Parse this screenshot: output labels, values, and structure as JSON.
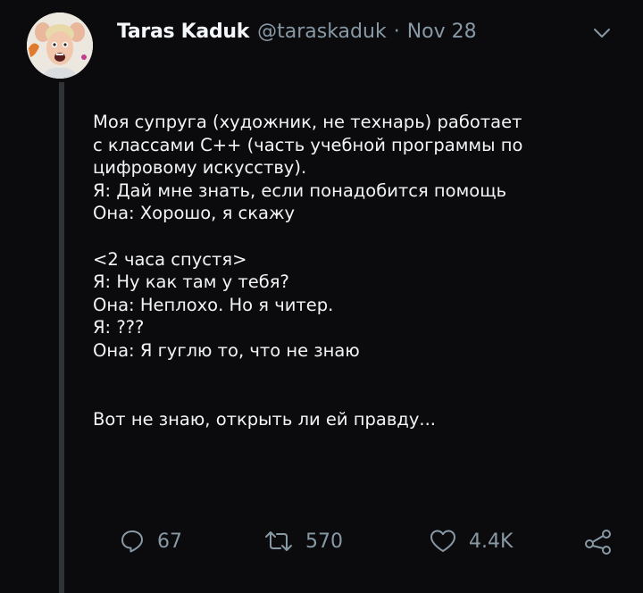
{
  "tweet": {
    "display_name": "Taras Kaduk",
    "handle": "@taraskaduk",
    "separator": "·",
    "date": "Nov 28",
    "lines": [
      "Моя супруга (художник, не технарь) работает",
      "с классами С++ (часть учебной программы по",
      "цифровому искусству).",
      "Я: Дай мне знать, если понадобится помощь",
      "Она: Хорошо, я скажу",
      "",
      "<2 часа спустя>",
      "Я: Ну как там у тебя?",
      "Она: Неплохо. Но я читер.",
      "Я: ???",
      "Она: Я гуглю то, что не знаю",
      "",
      "",
      "Вот не знаю, открыть ли ей правду..."
    ],
    "actions": {
      "replies": "67",
      "retweets": "570",
      "likes": "4.4K"
    }
  },
  "icons": {
    "menu": "chevron-down-icon",
    "reply": "reply-icon",
    "retweet": "retweet-icon",
    "like": "heart-icon",
    "share": "share-icon"
  },
  "colors": {
    "background": "#0b0b0d",
    "text": "#f2f4f6",
    "muted": "#8899a6",
    "thread_line": "#2f3336"
  }
}
